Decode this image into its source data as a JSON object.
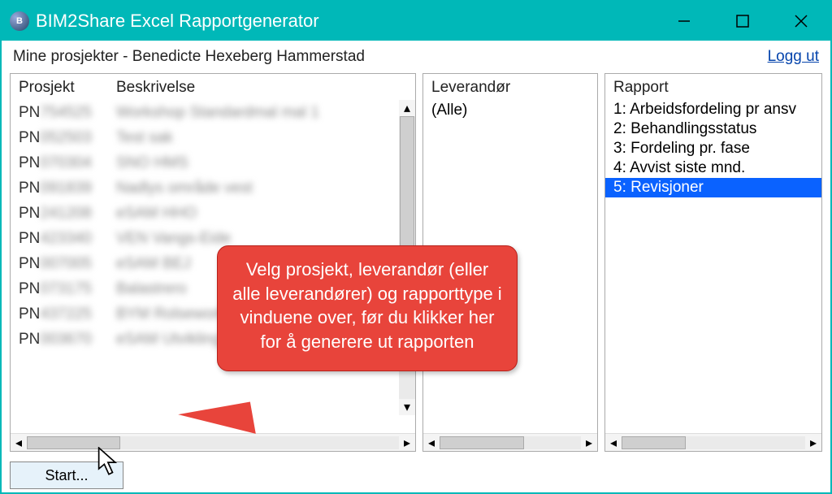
{
  "window": {
    "title": "BIM2Share Excel Rapportgenerator"
  },
  "subheader": {
    "text": "Mine prosjekter - Benedicte Hexeberg Hammerstad",
    "logout": "Logg ut"
  },
  "left": {
    "col_project": "Prosjekt",
    "col_desc": "Beskrivelse",
    "rows": [
      {
        "pn": "PN",
        "code": "754525",
        "desc": "Workshop  Standardmal mal 1"
      },
      {
        "pn": "PN",
        "code": "052503",
        "desc": "Test sak"
      },
      {
        "pn": "PN",
        "code": "070304",
        "desc": "SNO HMS"
      },
      {
        "pn": "PN",
        "code": "091839",
        "desc": "Nadlys område vest"
      },
      {
        "pn": "PN",
        "code": "241208",
        "desc": "eSAM HHO"
      },
      {
        "pn": "PN",
        "code": "423340",
        "desc": "VEN Vangs-Eide"
      },
      {
        "pn": "PN",
        "code": "007005",
        "desc": "eSAM BEJ"
      },
      {
        "pn": "PN",
        "code": "073175",
        "desc": "Balastrero"
      },
      {
        "pn": "PN",
        "code": "437225",
        "desc": "BYM  Rolseworks"
      },
      {
        "pn": "PN",
        "code": "003670",
        "desc": "eSAM Utvikling"
      }
    ]
  },
  "mid": {
    "header": "Leverandør",
    "items": [
      "(Alle)"
    ]
  },
  "right": {
    "header": "Rapport",
    "items": [
      {
        "label": "1: Arbeidsfordeling pr ansv",
        "selected": false
      },
      {
        "label": "2: Behandlingsstatus",
        "selected": false
      },
      {
        "label": "3: Fordeling pr. fase",
        "selected": false
      },
      {
        "label": "4: Avvist siste mnd.",
        "selected": false
      },
      {
        "label": "5: Revisjoner",
        "selected": true
      }
    ]
  },
  "start_label": "Start...",
  "callout": "Velg prosjekt, leverandør (eller alle leverandører) og rapporttype i vinduene over, før du klikker her for å generere ut rapporten"
}
